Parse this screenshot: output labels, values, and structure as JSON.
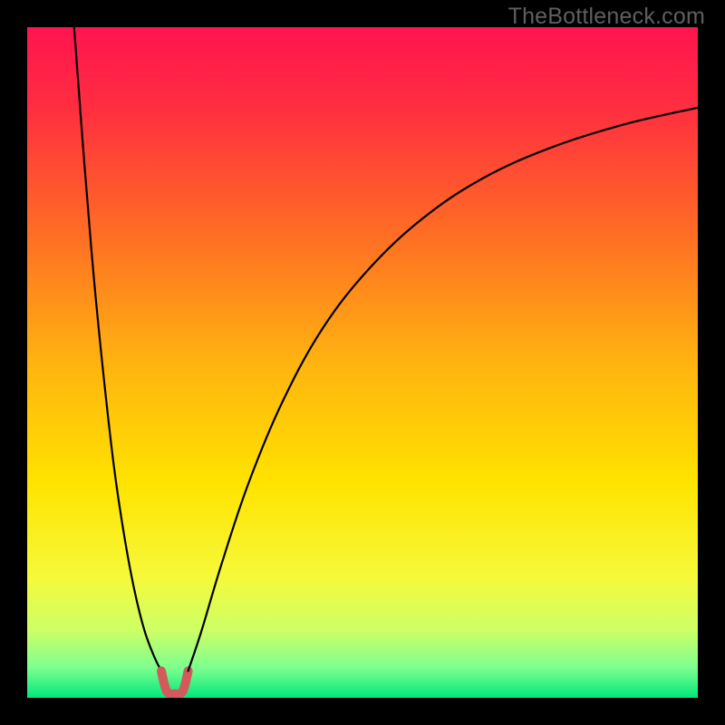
{
  "watermark": "TheBottleneck.com",
  "chart_data": {
    "type": "line",
    "title": "",
    "xlabel": "",
    "ylabel": "",
    "xlim": [
      0,
      100
    ],
    "ylim": [
      0,
      100
    ],
    "grid": false,
    "legend": false,
    "background_gradient": {
      "stops": [
        {
          "pos": 0.0,
          "color": "#ff1450"
        },
        {
          "pos": 0.12,
          "color": "#ff2e40"
        },
        {
          "pos": 0.3,
          "color": "#ff6a25"
        },
        {
          "pos": 0.5,
          "color": "#ffb310"
        },
        {
          "pos": 0.68,
          "color": "#ffe300"
        },
        {
          "pos": 0.82,
          "color": "#f6f93a"
        },
        {
          "pos": 0.9,
          "color": "#ccff66"
        },
        {
          "pos": 0.955,
          "color": "#7dff8f"
        },
        {
          "pos": 1.0,
          "color": "#00e87a"
        }
      ]
    },
    "series": [
      {
        "name": "left-curve",
        "stroke": "#000000",
        "stroke_width": 2.2,
        "x": [
          7.0,
          8.5,
          10.0,
          11.5,
          13.0,
          14.5,
          16.0,
          17.5,
          19.0,
          20.0
        ],
        "y": [
          100.0,
          80.0,
          62.0,
          47.0,
          34.0,
          24.0,
          16.0,
          10.0,
          6.0,
          4.0
        ]
      },
      {
        "name": "dip",
        "stroke": "#d25a5a",
        "stroke_width": 10,
        "x": [
          20.0,
          20.8,
          22.0,
          23.2,
          24.0
        ],
        "y": [
          4.0,
          1.0,
          0.6,
          1.0,
          4.0
        ]
      },
      {
        "name": "right-curve",
        "stroke": "#000000",
        "stroke_width": 2.2,
        "x": [
          24.0,
          26.0,
          29.0,
          33.0,
          38.0,
          44.0,
          51.0,
          59.0,
          68.0,
          78.0,
          89.0,
          100.0
        ],
        "y": [
          4.0,
          10.0,
          20.0,
          32.0,
          44.0,
          55.0,
          64.0,
          71.5,
          77.5,
          82.0,
          85.5,
          88.0
        ]
      }
    ]
  }
}
